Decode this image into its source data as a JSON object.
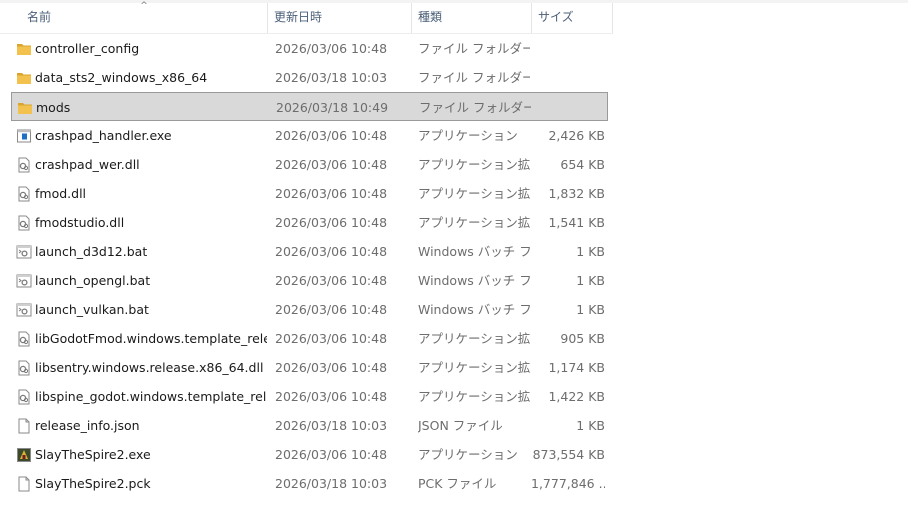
{
  "header": {
    "name": "名前",
    "date": "更新日時",
    "type": "種類",
    "size": "サイズ",
    "sort_glyph": "^"
  },
  "colors": {
    "folder": "#f2c14e",
    "folder_dark": "#d9a52e",
    "selection": "#d9d9d9",
    "header_text": "#4c607a",
    "meta_text": "#6d6d6d"
  },
  "files": [
    {
      "name": "controller_config",
      "date": "2026/03/06 10:48",
      "type": "ファイル フォルダー",
      "size": "",
      "icon": "folder-icon",
      "selected": false
    },
    {
      "name": "data_sts2_windows_x86_64",
      "date": "2026/03/18 10:03",
      "type": "ファイル フォルダー",
      "size": "",
      "icon": "folder-icon",
      "selected": false
    },
    {
      "name": "mods",
      "date": "2026/03/18 10:49",
      "type": "ファイル フォルダー",
      "size": "",
      "icon": "folder-icon",
      "selected": true
    },
    {
      "name": "crashpad_handler.exe",
      "date": "2026/03/06 10:48",
      "type": "アプリケーション",
      "size": "2,426 KB",
      "icon": "exe-icon",
      "selected": false
    },
    {
      "name": "crashpad_wer.dll",
      "date": "2026/03/06 10:48",
      "type": "アプリケーション拡張",
      "size": "654 KB",
      "icon": "dll-icon",
      "selected": false
    },
    {
      "name": "fmod.dll",
      "date": "2026/03/06 10:48",
      "type": "アプリケーション拡張",
      "size": "1,832 KB",
      "icon": "dll-icon",
      "selected": false
    },
    {
      "name": "fmodstudio.dll",
      "date": "2026/03/06 10:48",
      "type": "アプリケーション拡張",
      "size": "1,541 KB",
      "icon": "dll-icon",
      "selected": false
    },
    {
      "name": "launch_d3d12.bat",
      "date": "2026/03/06 10:48",
      "type": "Windows バッチ ファ...",
      "size": "1 KB",
      "icon": "bat-icon",
      "selected": false
    },
    {
      "name": "launch_opengl.bat",
      "date": "2026/03/06 10:48",
      "type": "Windows バッチ ファ...",
      "size": "1 KB",
      "icon": "bat-icon",
      "selected": false
    },
    {
      "name": "launch_vulkan.bat",
      "date": "2026/03/06 10:48",
      "type": "Windows バッチ ファ...",
      "size": "1 KB",
      "icon": "bat-icon",
      "selected": false
    },
    {
      "name": "libGodotFmod.windows.template_release...",
      "date": "2026/03/06 10:48",
      "type": "アプリケーション拡張",
      "size": "905 KB",
      "icon": "dll-icon",
      "selected": false
    },
    {
      "name": "libsentry.windows.release.x86_64.dll",
      "date": "2026/03/06 10:48",
      "type": "アプリケーション拡張",
      "size": "1,174 KB",
      "icon": "dll-icon",
      "selected": false
    },
    {
      "name": "libspine_godot.windows.template_releas...",
      "date": "2026/03/06 10:48",
      "type": "アプリケーション拡張",
      "size": "1,422 KB",
      "icon": "dll-icon",
      "selected": false
    },
    {
      "name": "release_info.json",
      "date": "2026/03/18 10:03",
      "type": "JSON ファイル",
      "size": "1 KB",
      "icon": "document-icon",
      "selected": false
    },
    {
      "name": "SlayTheSpire2.exe",
      "date": "2026/03/06 10:48",
      "type": "アプリケーション",
      "size": "873,554 KB",
      "icon": "game-exe-icon",
      "selected": false
    },
    {
      "name": "SlayTheSpire2.pck",
      "date": "2026/03/18 10:03",
      "type": "PCK ファイル",
      "size": "1,777,846 ...",
      "icon": "document-icon",
      "selected": false
    }
  ]
}
